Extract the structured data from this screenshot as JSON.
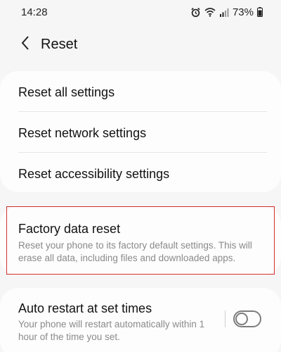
{
  "status_bar": {
    "time": "14:28",
    "battery_percent": "73%",
    "icons": [
      "alarm-icon",
      "wifi-icon",
      "signal-icon",
      "battery-icon"
    ]
  },
  "header": {
    "back_icon": "chevron-left-icon",
    "title": "Reset"
  },
  "reset_options": [
    {
      "label": "Reset all settings"
    },
    {
      "label": "Reset network settings"
    },
    {
      "label": "Reset accessibility settings"
    }
  ],
  "factory_reset": {
    "title": "Factory data reset",
    "description": "Reset your phone to its factory default settings. This will erase all data, including files and downloaded apps.",
    "highlight_color": "#d32f2f"
  },
  "auto_restart": {
    "title": "Auto restart at set times",
    "description": "Your phone will restart automatically within 1 hour of the time you set.",
    "toggle_on": false
  }
}
